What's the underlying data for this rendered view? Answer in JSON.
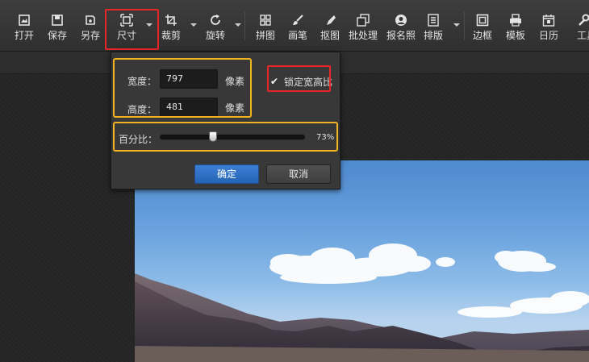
{
  "toolbar": {
    "items": [
      {
        "label": "打开",
        "icon": "open-icon"
      },
      {
        "label": "保存",
        "icon": "save-icon"
      },
      {
        "label": "另存",
        "icon": "save-as-icon"
      },
      {
        "label": "尺寸",
        "icon": "resize-icon"
      },
      {
        "label": "裁剪",
        "icon": "crop-icon"
      },
      {
        "label": "旋转",
        "icon": "rotate-icon"
      },
      {
        "label": "拼图",
        "icon": "collage-icon"
      },
      {
        "label": "画笔",
        "icon": "brush-icon"
      },
      {
        "label": "抠图",
        "icon": "cutout-icon"
      },
      {
        "label": "批处理",
        "icon": "batch-icon"
      },
      {
        "label": "报名照",
        "icon": "id-photo-icon"
      },
      {
        "label": "排版",
        "icon": "layout-icon"
      },
      {
        "label": "边框",
        "icon": "border-icon"
      },
      {
        "label": "模板",
        "icon": "template-icon"
      },
      {
        "label": "日历",
        "icon": "calendar-icon"
      },
      {
        "label": "工具",
        "icon": "tools-icon"
      }
    ]
  },
  "resize_dialog": {
    "width_label": "宽度：",
    "width_value": "797",
    "height_label": "高度：",
    "height_value": "481",
    "unit": "像素",
    "lock_ratio_label": "锁定宽高比",
    "lock_ratio_checked": true,
    "percent_label": "百分比：",
    "percent_value": 73,
    "percent_text": "73%",
    "confirm_label": "确定",
    "cancel_label": "取消"
  },
  "colors": {
    "highlight_red": "#e8262a",
    "highlight_yellow": "#f2b320",
    "primary_button": "#2d6fc4"
  }
}
